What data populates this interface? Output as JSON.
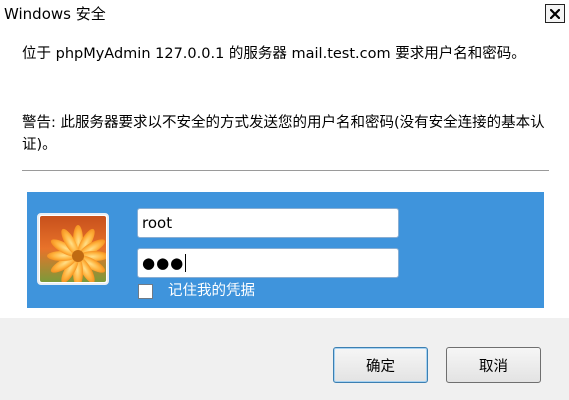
{
  "window": {
    "title": "Windows 安全",
    "close_icon": "close-icon"
  },
  "message": {
    "line1": "位于 phpMyAdmin 127.0.0.1 的服务器 mail.test.com 要求用户名和密码。",
    "warning": "警告: 此服务器要求以不安全的方式发送您的用户名和密码(没有安全连接的基本认证)。"
  },
  "credentials": {
    "avatar_icon": "user-avatar-flower-icon",
    "username_value": "root",
    "password_masked": "●●●",
    "remember_label": "记住我的凭据",
    "remember_checked": false,
    "panel_color": "#3f94dc"
  },
  "buttons": {
    "ok_label": "确定",
    "cancel_label": "取消"
  }
}
